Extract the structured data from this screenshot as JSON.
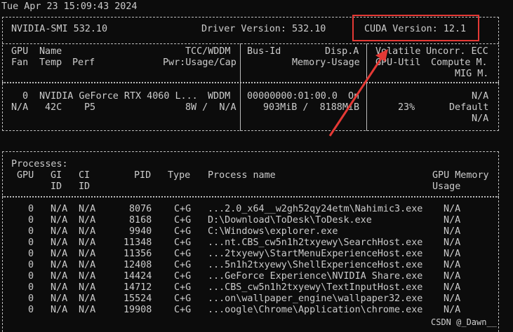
{
  "timestamp": "Tue Apr 23 15:09:43 2024",
  "header": {
    "smi": "NVIDIA-SMI 532.10",
    "driver": "Driver Version: 532.10",
    "cuda": "CUDA Version: 12.1"
  },
  "gpu_headers": {
    "row1": {
      "gpu": "GPU",
      "name": "Name",
      "tcc": "TCC/WDDM",
      "busid": "Bus-Id",
      "dispa": "Disp.A",
      "volatile": "Volatile",
      "uncorr": "Uncorr. ECC"
    },
    "row2": {
      "fan": "Fan",
      "temp": "Temp",
      "perf": "Perf",
      "pwr": "Pwr:Usage/Cap",
      "mem": "Memory-Usage",
      "util": "GPU-Util",
      "compute": "Compute M."
    },
    "row3": {
      "mig": "MIG M."
    }
  },
  "gpu": {
    "id": "0",
    "name": "NVIDIA GeForce RTX 4060 L...",
    "mode": "WDDM",
    "bus_id": "00000000:01:00.0",
    "disp": "On",
    "ecc": "N/A",
    "fan": "N/A",
    "temp": "42C",
    "perf": "P5",
    "power": "8W /  N/A",
    "memory": "903MiB /  8188MiB",
    "util": "23%",
    "compute": "Default",
    "mig": "N/A"
  },
  "processes": {
    "title": "Processes:",
    "headers": {
      "gpu": "GPU",
      "gi": "GI",
      "ci": "CI",
      "pid": "PID",
      "type": "Type",
      "name": "Process name",
      "gpu_memory": "GPU Memory",
      "id_gi": "ID",
      "id_ci": "ID",
      "usage": "Usage"
    },
    "rows": [
      {
        "gpu": "0",
        "gi": "N/A",
        "ci": "N/A",
        "pid": "8076",
        "type": "C+G",
        "name": "...2.0_x64__w2gh52qy24etm\\Nahimic3.exe",
        "mem": "N/A"
      },
      {
        "gpu": "0",
        "gi": "N/A",
        "ci": "N/A",
        "pid": "8168",
        "type": "C+G",
        "name": "D:\\Download\\ToDesk\\ToDesk.exe",
        "mem": "N/A"
      },
      {
        "gpu": "0",
        "gi": "N/A",
        "ci": "N/A",
        "pid": "9940",
        "type": "C+G",
        "name": "C:\\Windows\\explorer.exe",
        "mem": "N/A"
      },
      {
        "gpu": "0",
        "gi": "N/A",
        "ci": "N/A",
        "pid": "11348",
        "type": "C+G",
        "name": "...nt.CBS_cw5n1h2txyewy\\SearchHost.exe",
        "mem": "N/A"
      },
      {
        "gpu": "0",
        "gi": "N/A",
        "ci": "N/A",
        "pid": "11356",
        "type": "C+G",
        "name": "...2txyewy\\StartMenuExperienceHost.exe",
        "mem": "N/A"
      },
      {
        "gpu": "0",
        "gi": "N/A",
        "ci": "N/A",
        "pid": "12408",
        "type": "C+G",
        "name": "...5n1h2txyewy\\ShellExperienceHost.exe",
        "mem": "N/A"
      },
      {
        "gpu": "0",
        "gi": "N/A",
        "ci": "N/A",
        "pid": "14424",
        "type": "C+G",
        "name": "...GeForce Experience\\NVIDIA Share.exe",
        "mem": "N/A"
      },
      {
        "gpu": "0",
        "gi": "N/A",
        "ci": "N/A",
        "pid": "14712",
        "type": "C+G",
        "name": "...CBS_cw5n1h2txyewy\\TextInputHost.exe",
        "mem": "N/A"
      },
      {
        "gpu": "0",
        "gi": "N/A",
        "ci": "N/A",
        "pid": "15524",
        "type": "C+G",
        "name": "...on\\wallpaper_engine\\wallpaper32.exe",
        "mem": "N/A"
      },
      {
        "gpu": "0",
        "gi": "N/A",
        "ci": "N/A",
        "pid": "19908",
        "type": "C+G",
        "name": "...oogle\\Chrome\\Application\\chrome.exe",
        "mem": "N/A"
      }
    ]
  },
  "watermark": "CSDN @_Dawn__",
  "colors": {
    "background": "#0c0c0c",
    "text": "#cccccc",
    "highlight": "#e53935"
  }
}
